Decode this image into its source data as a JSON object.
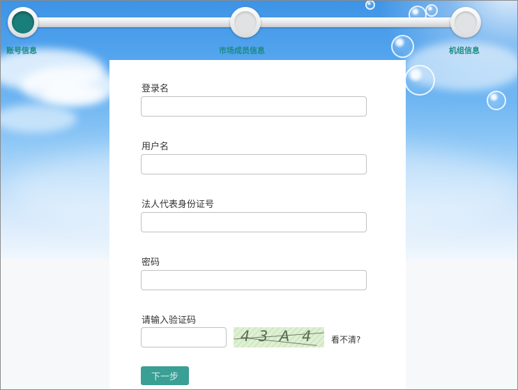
{
  "stepper": {
    "steps": [
      {
        "label": "账号信息",
        "active": true
      },
      {
        "label": "市场成员信息",
        "active": false
      },
      {
        "label": "机组信息",
        "active": false
      }
    ],
    "active_color": "#1a7f7a",
    "label_color": "#1c8a83"
  },
  "form": {
    "fields": [
      {
        "label": "登录名",
        "value": ""
      },
      {
        "label": "用户名",
        "value": ""
      },
      {
        "label": "法人代表身份证号",
        "value": ""
      },
      {
        "label": "密码",
        "value": ""
      }
    ],
    "captcha": {
      "label": "请输入验证码",
      "value": "",
      "image_text": [
        "4",
        "3",
        "A",
        "4"
      ],
      "refresh_label": "看不清?"
    },
    "next_label": "下一步",
    "next_color": "#3a9f95"
  }
}
